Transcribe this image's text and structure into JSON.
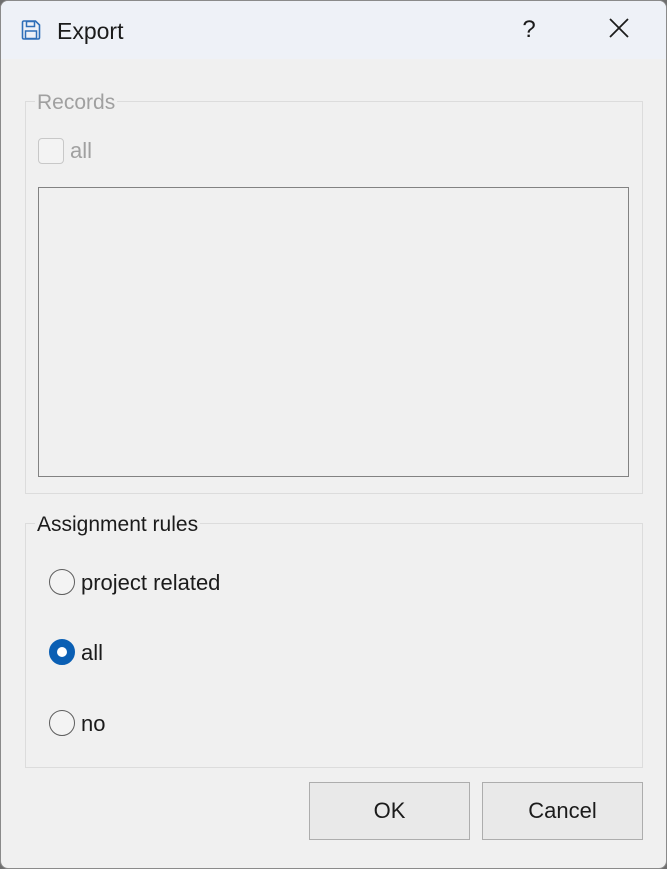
{
  "window": {
    "title": "Export",
    "icon": "save-icon",
    "help_label": "?",
    "close_icon": "close-icon"
  },
  "records": {
    "title": "Records",
    "all_checkbox": {
      "label": "all",
      "checked": false,
      "enabled": false
    },
    "list_items": []
  },
  "assignment_rules": {
    "title": "Assignment rules",
    "options": [
      {
        "label": "project related",
        "selected": false
      },
      {
        "label": "all",
        "selected": true
      },
      {
        "label": "no",
        "selected": false
      }
    ]
  },
  "buttons": {
    "ok_label": "OK",
    "cancel_label": "Cancel"
  },
  "colors": {
    "accent": "#0a5fb4",
    "disabled_text": "#a0a0a0",
    "background": "#f0f0f0",
    "titlebar": "#eef1f7"
  }
}
